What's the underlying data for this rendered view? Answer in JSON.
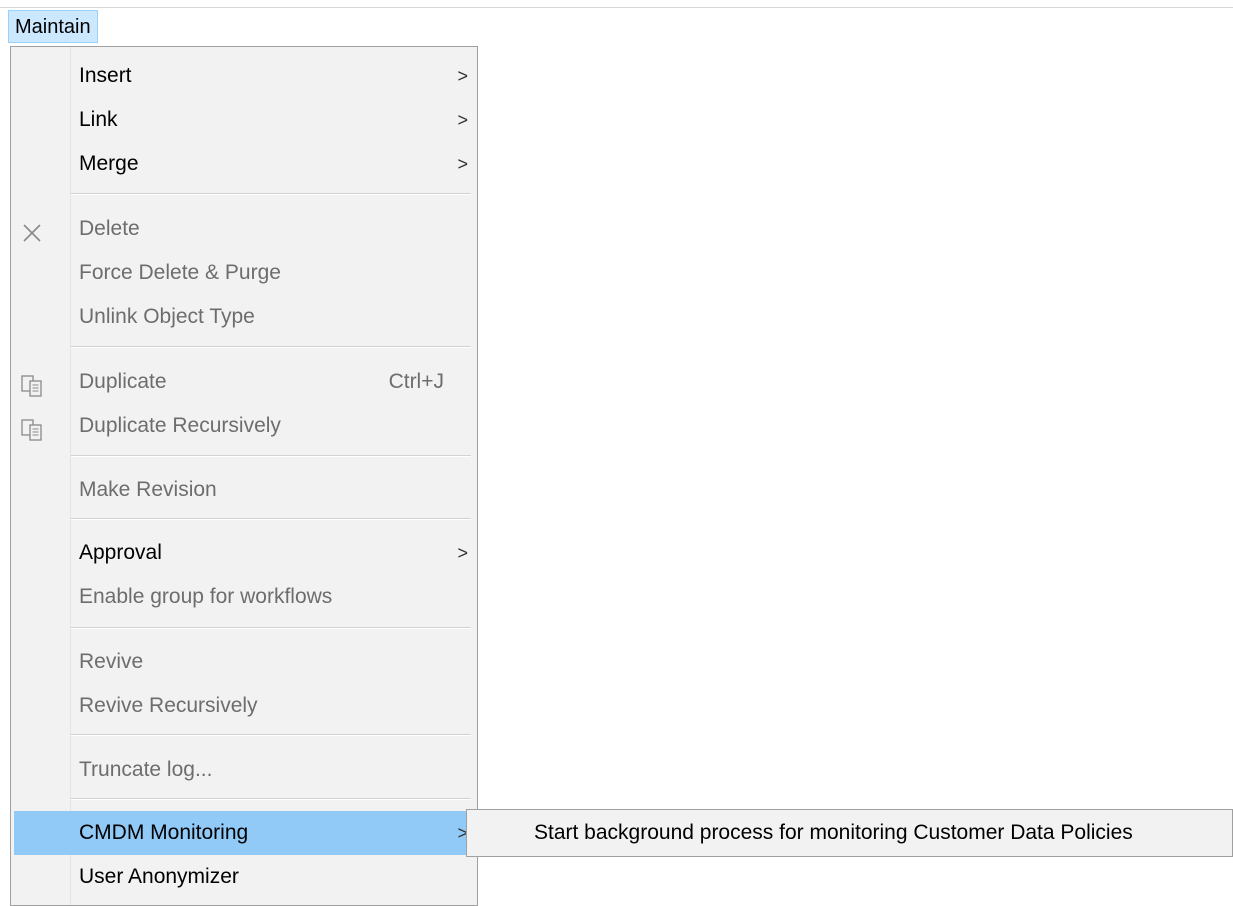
{
  "menubar": {
    "maintain_label": "Maintain"
  },
  "menu": {
    "insert": "Insert",
    "link": "Link",
    "merge": "Merge",
    "delete": "Delete",
    "force_delete": "Force Delete & Purge",
    "unlink_object_type": "Unlink Object Type",
    "duplicate": "Duplicate",
    "duplicate_shortcut": "Ctrl+J",
    "duplicate_recursively": "Duplicate Recursively",
    "make_revision": "Make Revision",
    "approval": "Approval",
    "enable_group": "Enable group for workflows",
    "revive": "Revive",
    "revive_recursively": "Revive Recursively",
    "truncate_log": "Truncate log...",
    "cmdm_monitoring": "CMDM Monitoring",
    "user_anonymizer": "User Anonymizer",
    "submenu_arrow": ">"
  },
  "submenu": {
    "start_background": "Start background process for monitoring Customer Data Policies"
  },
  "colors": {
    "highlight": "#91c9f7",
    "menubar_active": "#cce8ff",
    "disabled_text": "#6d6d6d"
  }
}
